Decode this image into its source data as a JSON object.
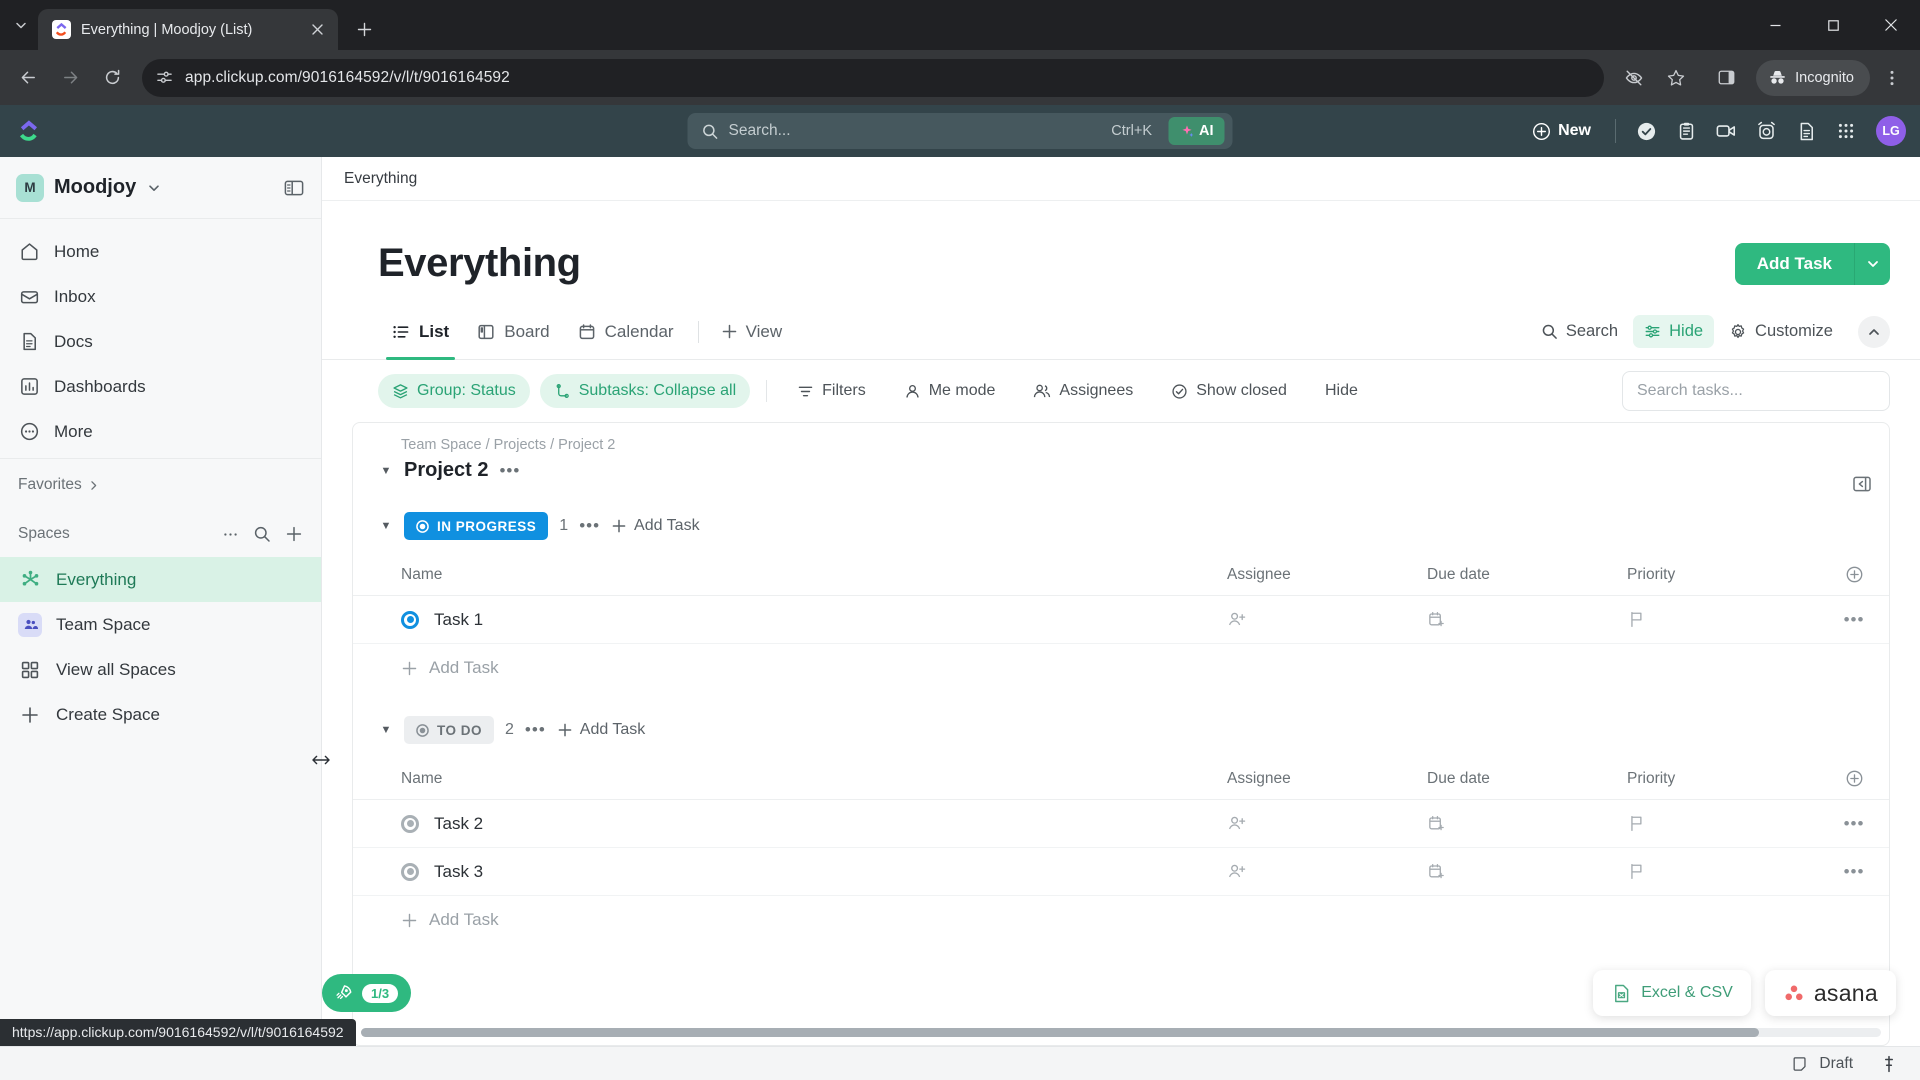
{
  "browser": {
    "tab": {
      "title": "Everything | Moodjoy (List)",
      "favicon": "clickup-favicon",
      "close_icon": "close-icon"
    },
    "new_tab_label": "+",
    "tab_list_chevron": "chevron-down-icon",
    "window": {
      "minimize": "minimize-icon",
      "maximize": "maximize-icon",
      "close": "close-icon"
    },
    "nav": {
      "back": "back-arrow-icon",
      "forward": "forward-arrow-icon",
      "reload": "reload-icon"
    },
    "omnibox": {
      "site_icon": "site-settings-icon",
      "url": "app.clickup.com/9016164592/v/l/t/9016164592"
    },
    "actions": {
      "hide_password_icon": "eye-slash-icon",
      "bookmark_icon": "star-icon",
      "side_panel_icon": "side-panel-icon",
      "incognito_label": "Incognito",
      "incognito_icon": "incognito-icon",
      "menu_icon": "three-dots-vertical-icon"
    },
    "status_link": "https://app.clickup.com/9016164592/v/l/t/9016164592"
  },
  "topbar": {
    "logo": "clickup-logo",
    "search": {
      "placeholder": "Search...",
      "icon": "search-icon",
      "shortcut": "Ctrl+K"
    },
    "ai_label": "AI",
    "ai_icon": "sparkle-icon",
    "new_label": "New",
    "new_icon": "plus-circle-icon",
    "icons": [
      {
        "name": "check-circle-icon"
      },
      {
        "name": "clipboard-icon"
      },
      {
        "name": "video-camera-icon"
      },
      {
        "name": "alarm-clock-icon"
      },
      {
        "name": "document-icon"
      },
      {
        "name": "apps-grid-icon"
      }
    ],
    "avatar_initials": "LG"
  },
  "sidebar": {
    "workspace": {
      "badge": "M",
      "name": "Moodjoy",
      "caret_icon": "chevron-down-icon"
    },
    "panel_toggle_icon": "sidebar-toggle-icon",
    "nav_items": [
      {
        "label": "Home",
        "icon": "home-icon"
      },
      {
        "label": "Inbox",
        "icon": "inbox-icon"
      },
      {
        "label": "Docs",
        "icon": "docs-icon"
      },
      {
        "label": "Dashboards",
        "icon": "dashboards-icon"
      },
      {
        "label": "More",
        "icon": "more-circle-icon"
      }
    ],
    "favorites_label": "Favorites",
    "favorites_chevron": "chevron-right-icon",
    "spaces_label": "Spaces",
    "spaces_actions": [
      {
        "name": "ellipsis-icon"
      },
      {
        "name": "search-icon"
      },
      {
        "name": "plus-icon"
      }
    ],
    "spaces": [
      {
        "label": "Everything",
        "icon": "everything-asterisk-icon",
        "active": true
      },
      {
        "label": "Team Space",
        "icon": "team-space-icon",
        "active": false
      },
      {
        "label": "View all Spaces",
        "icon": "grid-squares-icon",
        "active": false
      },
      {
        "label": "Create Space",
        "icon": "plus-icon",
        "active": false
      }
    ],
    "resizer_icon": "resize-handle-icon"
  },
  "main": {
    "breadcrumb": "Everything",
    "page_title": "Everything",
    "add_task_label": "Add Task",
    "add_task_caret_icon": "chevron-down-icon",
    "view_tabs": [
      {
        "label": "List",
        "icon": "list-icon",
        "active": true
      },
      {
        "label": "Board",
        "icon": "board-icon",
        "active": false
      },
      {
        "label": "Calendar",
        "icon": "calendar-icon",
        "active": false
      }
    ],
    "add_view_label": "View",
    "add_view_icon": "plus-icon",
    "tabs_right": [
      {
        "label": "Search",
        "icon": "search-icon",
        "highlight": false
      },
      {
        "label": "Hide",
        "icon": "sliders-icon",
        "highlight": true
      },
      {
        "label": "Customize",
        "icon": "gear-icon",
        "highlight": false
      }
    ],
    "collapse_icon": "chevron-up-icon",
    "filters": [
      {
        "label": "Group: Status",
        "icon": "layers-icon",
        "style": "green"
      },
      {
        "label": "Subtasks: Collapse all",
        "icon": "subtasks-icon",
        "style": "green"
      },
      {
        "label": "Filters",
        "icon": "filter-icon",
        "style": "plain"
      },
      {
        "label": "Me mode",
        "icon": "person-icon",
        "style": "plain"
      },
      {
        "label": "Assignees",
        "icon": "people-icon",
        "style": "plain"
      },
      {
        "label": "Show closed",
        "icon": "check-circle-outline-icon",
        "style": "plain"
      },
      {
        "label": "Hide",
        "icon": "",
        "style": "plain"
      }
    ],
    "search_tasks_placeholder": "Search tasks...",
    "group": {
      "breadcrumb": "Team Space / Projects / Project 2",
      "title": "Project 2",
      "menu_icon": "ellipsis-icon",
      "caret_icon": "caret-down-icon",
      "collapse_panel_icon": "collapse-panel-icon"
    },
    "columns": [
      "Name",
      "Assignee",
      "Due date",
      "Priority"
    ],
    "add_column_icon": "plus-circle-icon",
    "status_groups": [
      {
        "status": "IN PROGRESS",
        "style": "inprogress",
        "count": "1",
        "menu_icon": "ellipsis-icon",
        "add_task_label": "Add Task",
        "tasks": [
          {
            "name": "Task 1",
            "dot": "blue",
            "assignee_icon": "add-assignee-icon",
            "due_icon": "add-date-icon",
            "priority_icon": "flag-icon",
            "more_icon": "ellipsis-icon"
          }
        ],
        "footer_add_label": "Add Task"
      },
      {
        "status": "TO DO",
        "style": "todo",
        "count": "2",
        "menu_icon": "ellipsis-icon",
        "add_task_label": "Add Task",
        "tasks": [
          {
            "name": "Task 2",
            "dot": "grey",
            "assignee_icon": "add-assignee-icon",
            "due_icon": "add-date-icon",
            "priority_icon": "flag-icon",
            "more_icon": "ellipsis-icon"
          },
          {
            "name": "Task 3",
            "dot": "grey",
            "assignee_icon": "add-assignee-icon",
            "due_icon": "add-date-icon",
            "priority_icon": "flag-icon",
            "more_icon": "ellipsis-icon"
          }
        ],
        "footer_add_label": "Add Task"
      }
    ],
    "rocket": {
      "icon": "rocket-icon",
      "badge": "1/3"
    },
    "promos": [
      {
        "label": "Excel & CSV",
        "icon": "excel-file-icon"
      },
      {
        "label": "asana",
        "icon": "asana-logo-icon"
      }
    ]
  },
  "statusbar": {
    "draft_label": "Draft",
    "draft_icon": "draft-note-icon",
    "pin_icon": "pin-icon"
  },
  "colors": {
    "clickup_green": "#2fb980",
    "topbar_dark": "#33444a",
    "in_progress_blue": "#1090e0",
    "todo_grey": "#a9b0b5",
    "accent_green_soft": "#d9f2e6"
  }
}
